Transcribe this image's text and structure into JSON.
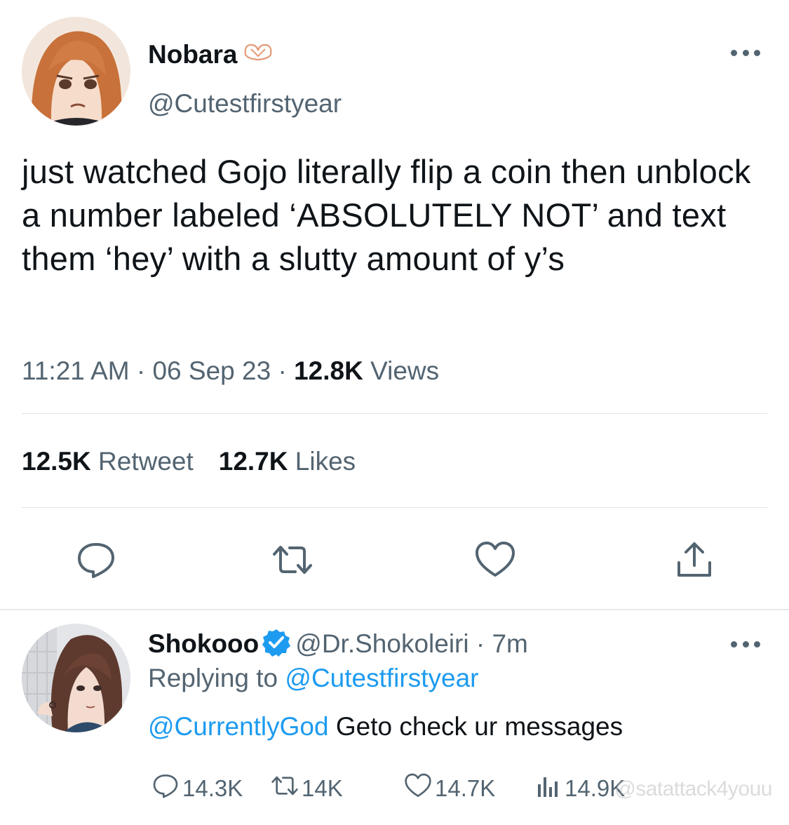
{
  "tweet": {
    "display_name": "Nobara",
    "name_emoji": "heart-hands-emoji",
    "handle": "@Cutestfirstyear",
    "text": "just watched Gojo literally flip a coin then unblock a number labeled ‘ABSOLUTELY NOT’ and text them ‘hey’ with a slutty amount of y’s",
    "time": "11:21 AM",
    "date": "06 Sep 23",
    "separator": "·",
    "views_count": "12.8K",
    "views_label": "Views",
    "retweets_count": "12.5K",
    "retweets_label": "Retweet",
    "likes_count": "12.7K",
    "likes_label": "Likes",
    "actions": [
      "reply-icon",
      "retweet-icon",
      "like-icon",
      "share-icon"
    ]
  },
  "reply": {
    "display_name": "Shokooo",
    "verified": true,
    "handle": "@Dr.Shokoleiri",
    "separator": "·",
    "time": "7m",
    "replying_label": "Replying to",
    "replying_to": "@Cutestfirstyear",
    "mention": "@CurrentlyGod",
    "text": "Geto check ur messages",
    "reply_count": "14.3K",
    "retweet_count": "14K",
    "like_count": "14.7K",
    "views_count": "14.9K"
  },
  "watermark": "@satattack4youu",
  "colors": {
    "text": "#0f1419",
    "secondary": "#536471",
    "link": "#1d9bf0",
    "divider": "#e1e5e8",
    "verified": "#1d9bf0"
  }
}
